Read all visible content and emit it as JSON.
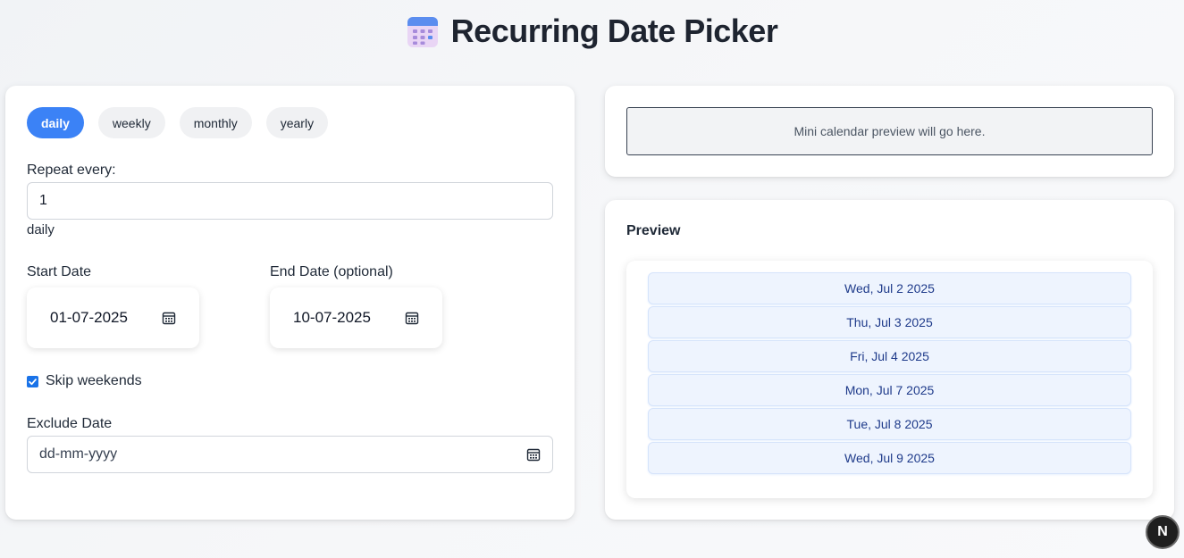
{
  "header": {
    "title": "Recurring Date Picker",
    "icon": "calendar-icon"
  },
  "frequency": {
    "tabs": [
      {
        "label": "daily",
        "active": true
      },
      {
        "label": "weekly",
        "active": false
      },
      {
        "label": "monthly",
        "active": false
      },
      {
        "label": "yearly",
        "active": false
      }
    ]
  },
  "repeat": {
    "label": "Repeat every:",
    "value": "1",
    "unit": "daily"
  },
  "start_date": {
    "label": "Start Date",
    "value": "01-07-2025"
  },
  "end_date": {
    "label": "End Date (optional)",
    "value": "10-07-2025"
  },
  "skip_weekends": {
    "label": "Skip weekends",
    "checked": true
  },
  "exclude_date": {
    "label": "Exclude Date",
    "placeholder": "dd-mm-yyyy"
  },
  "mini_calendar": {
    "text": "Mini calendar preview will go here."
  },
  "preview": {
    "title": "Preview",
    "dates": [
      "Wed, Jul 2 2025",
      "Thu, Jul 3 2025",
      "Fri, Jul 4 2025",
      "Mon, Jul 7 2025",
      "Tue, Jul 8 2025",
      "Wed, Jul 9 2025"
    ]
  },
  "badge": {
    "letter": "N"
  },
  "colors": {
    "accent": "#3b82f6",
    "checkbox": "#1a73e8",
    "date_item_bg": "#eef4fe",
    "date_item_text": "#1e3a8a"
  }
}
